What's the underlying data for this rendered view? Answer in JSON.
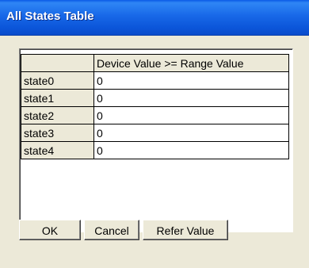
{
  "window": {
    "title": "All States Table"
  },
  "grid": {
    "column_header": "Device Value >= Range Value",
    "rows": [
      {
        "label": "state0",
        "value": "0"
      },
      {
        "label": "state1",
        "value": "0"
      },
      {
        "label": "state2",
        "value": "0"
      },
      {
        "label": "state3",
        "value": "0"
      },
      {
        "label": "state4",
        "value": "0"
      }
    ]
  },
  "buttons": {
    "ok": "OK",
    "cancel": "Cancel",
    "refer": "Refer Value"
  }
}
